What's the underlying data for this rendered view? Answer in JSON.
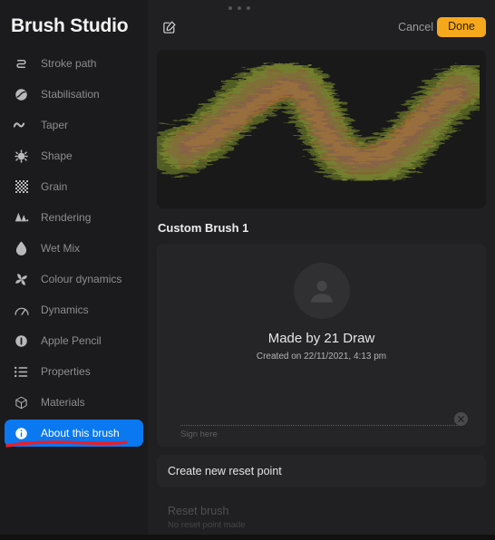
{
  "sidebar": {
    "title": "Brush Studio",
    "items": [
      {
        "label": "Stroke path",
        "icon": "stroke-path-icon",
        "selected": false
      },
      {
        "label": "Stabilisation",
        "icon": "stabilisation-icon",
        "selected": false
      },
      {
        "label": "Taper",
        "icon": "taper-icon",
        "selected": false
      },
      {
        "label": "Shape",
        "icon": "shape-icon",
        "selected": false
      },
      {
        "label": "Grain",
        "icon": "grain-icon",
        "selected": false
      },
      {
        "label": "Rendering",
        "icon": "rendering-icon",
        "selected": false
      },
      {
        "label": "Wet Mix",
        "icon": "wet-mix-icon",
        "selected": false
      },
      {
        "label": "Colour dynamics",
        "icon": "colour-dynamics-icon",
        "selected": false
      },
      {
        "label": "Dynamics",
        "icon": "dynamics-icon",
        "selected": false
      },
      {
        "label": "Apple Pencil",
        "icon": "apple-pencil-icon",
        "selected": false
      },
      {
        "label": "Properties",
        "icon": "properties-icon",
        "selected": false
      },
      {
        "label": "Materials",
        "icon": "materials-icon",
        "selected": false
      },
      {
        "label": "About this brush",
        "icon": "info-icon",
        "selected": true
      }
    ],
    "annotation_color": "#ee1c25"
  },
  "topbar": {
    "drag_handle": "drag-handle-dots",
    "edit_icon": "edit-square-pencil-icon",
    "cancel_label": "Cancel",
    "done_label": "Done",
    "done_color": "#f6a81c"
  },
  "preview": {
    "name": "brush-stroke-preview",
    "background": "#191919",
    "stroke_colors": [
      "#6f7a2e",
      "#8a6a2c",
      "#4a5d22",
      "#9c4a5e",
      "#c07a2a",
      "#3f4f1c",
      "#7d8f3a"
    ]
  },
  "main": {
    "brush_name": "Custom Brush 1",
    "maker": {
      "avatar": "person-avatar-icon",
      "made_by": "Made by 21 Draw",
      "created_on": "Created on 22/11/2021, 4:13 pm",
      "sign_placeholder": "Sign here",
      "clear_icon": "clear-signature-x-icon"
    },
    "rows": [
      {
        "title": "Create new reset point",
        "sub": "",
        "disabled": false
      },
      {
        "title": "Reset brush",
        "sub": "No reset point made",
        "disabled": true
      }
    ]
  }
}
